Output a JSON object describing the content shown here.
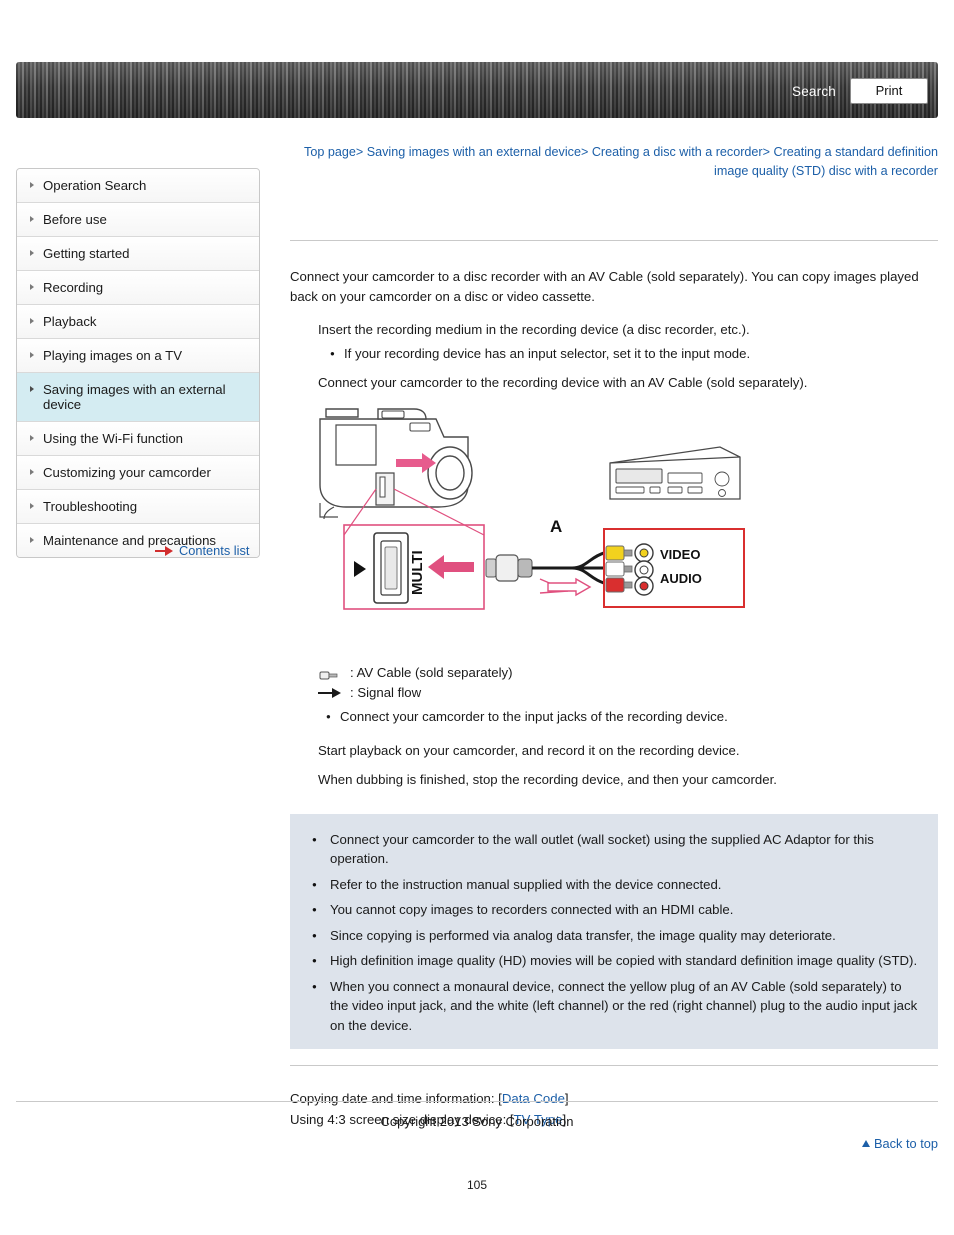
{
  "header": {
    "search_label": "Search",
    "print_label": "Print"
  },
  "breadcrumb": {
    "items": [
      "Top page",
      "Saving images with an external device",
      "Creating a disc with a recorder",
      "Creating a standard definition image quality (STD) disc with a recorder"
    ],
    "separator": ">"
  },
  "sidebar": {
    "items": [
      {
        "label": "Operation Search",
        "active": false
      },
      {
        "label": "Before use",
        "active": false
      },
      {
        "label": "Getting started",
        "active": false
      },
      {
        "label": "Recording",
        "active": false
      },
      {
        "label": "Playback",
        "active": false
      },
      {
        "label": "Playing images on a TV",
        "active": false
      },
      {
        "label": "Saving images with an external device",
        "active": true
      },
      {
        "label": "Using the Wi-Fi function",
        "active": false
      },
      {
        "label": "Customizing your camcorder",
        "active": false
      },
      {
        "label": "Troubleshooting",
        "active": false
      },
      {
        "label": "Maintenance and precautions",
        "active": false
      }
    ],
    "contents_list_label": "Contents list"
  },
  "main": {
    "intro": "Connect your camcorder to a disc recorder with an AV Cable (sold separately). You can copy images played back on your camcorder on a disc or video cassette.",
    "step1": "Insert the recording medium in the recording device (a disc recorder, etc.).",
    "step1_note": "If your recording device has an input selector, set it to the input mode.",
    "step2": "Connect your camcorder to the recording device with an AV Cable (sold separately).",
    "figure": {
      "label_a": "A",
      "multi_label": "MULTI",
      "video_label": "VIDEO",
      "audio_label": "AUDIO"
    },
    "legend_cable": ": AV Cable (sold separately)",
    "legend_signal": ": Signal flow",
    "legend_note": "Connect your camcorder to the input jacks of the recording device.",
    "step3": "Start playback on your camcorder, and record it on the recording device.",
    "step4": "When dubbing is finished, stop the recording device, and then your camcorder.",
    "notes": [
      "Connect your camcorder to the wall outlet (wall socket) using the supplied AC Adaptor for this operation.",
      "Refer to the instruction manual supplied with the device connected.",
      "You cannot copy images to recorders connected with an HDMI cable.",
      "Since copying is performed via analog data transfer, the image quality may deteriorate.",
      "High definition image quality (HD) movies will be copied with standard definition image quality (STD).",
      "When you connect a monaural device, connect the yellow plug of an AV Cable (sold separately) to the video input jack, and the white (left channel) or the red (right channel) plug to the audio input jack on the device."
    ],
    "footer_line1_prefix": "Copying date and time information: [",
    "footer_line1_link": "Data Code",
    "footer_line1_suffix": "]",
    "footer_line2_prefix": "Using 4:3 screen size display device: [",
    "footer_line2_link": "TV Type",
    "footer_line2_suffix": "]",
    "back_to_top": "Back to top"
  },
  "footer": {
    "copyright": "Copyright 2013 Sony Corporation",
    "page_number": "105"
  },
  "colors": {
    "link": "#1c5fa8",
    "active_sidebar": "#d4ecf2",
    "note_bg": "#dde3eb",
    "accent_red": "#d12d2d"
  }
}
